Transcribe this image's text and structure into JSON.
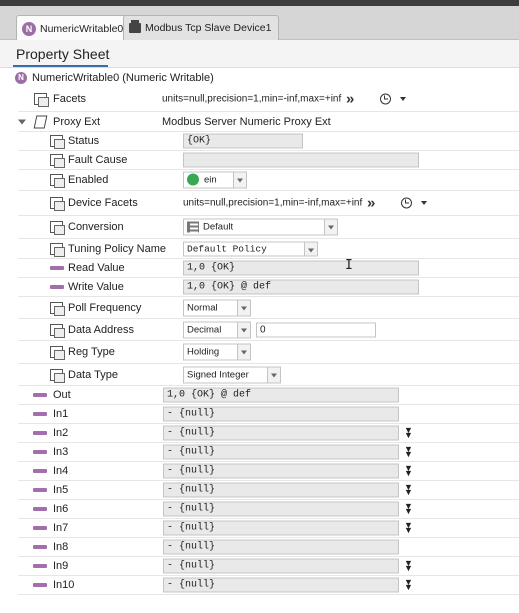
{
  "tabs": [
    {
      "label": "NumericWritable0",
      "icon": "N"
    },
    {
      "label": "Modbus Tcp Slave Device1",
      "icon": "device-icon"
    }
  ],
  "sheet": {
    "title": "Property Sheet"
  },
  "root": {
    "icon": "N",
    "label": "NumericWritable0  (Numeric Writable)"
  },
  "facets": {
    "label": "Facets",
    "value": "units=null,precision=1,min=-inf,max=+inf"
  },
  "proxy_ext": {
    "label": "Proxy Ext",
    "value": "Modbus Server Numeric Proxy Ext"
  },
  "proxy": {
    "status": {
      "label": "Status",
      "value": "{OK}"
    },
    "fault_cause": {
      "label": "Fault Cause",
      "value": ""
    },
    "enabled": {
      "label": "Enabled",
      "value": "ein"
    },
    "device_facets": {
      "label": "Device Facets",
      "value": "units=null,precision=1,min=-inf,max=+inf"
    },
    "conversion": {
      "label": "Conversion",
      "value": "Default"
    },
    "tuning_policy": {
      "label": "Tuning Policy Name",
      "value": "Default Policy"
    },
    "read_value": {
      "label": "Read Value",
      "value": "1,0 {OK}"
    },
    "write_value": {
      "label": "Write Value",
      "value": "1,0 {OK} @ def"
    },
    "poll_frequency": {
      "label": "Poll Frequency",
      "value": "Normal"
    },
    "data_address": {
      "label": "Data Address",
      "mode": "Decimal",
      "value": "0"
    },
    "reg_type": {
      "label": "Reg Type",
      "value": "Holding"
    },
    "data_type": {
      "label": "Data Type",
      "value": "Signed Integer"
    }
  },
  "out": {
    "label": "Out",
    "value": "1,0 {OK} @ def"
  },
  "inputs": [
    {
      "label": "In1",
      "value": "- {null}",
      "expand": false
    },
    {
      "label": "In2",
      "value": "- {null}",
      "expand": true
    },
    {
      "label": "In3",
      "value": "- {null}",
      "expand": true
    },
    {
      "label": "In4",
      "value": "- {null}",
      "expand": true
    },
    {
      "label": "In5",
      "value": "- {null}",
      "expand": true
    },
    {
      "label": "In6",
      "value": "- {null}",
      "expand": true
    },
    {
      "label": "In7",
      "value": "- {null}",
      "expand": true
    },
    {
      "label": "In8",
      "value": "- {null}",
      "expand": false
    },
    {
      "label": "In9",
      "value": "- {null}",
      "expand": true
    },
    {
      "label": "In10",
      "value": "- {null}",
      "expand": true
    }
  ],
  "colors": {
    "link": "#a16fae",
    "ok_green": "#39a852",
    "accent": "#3b6ea5"
  }
}
